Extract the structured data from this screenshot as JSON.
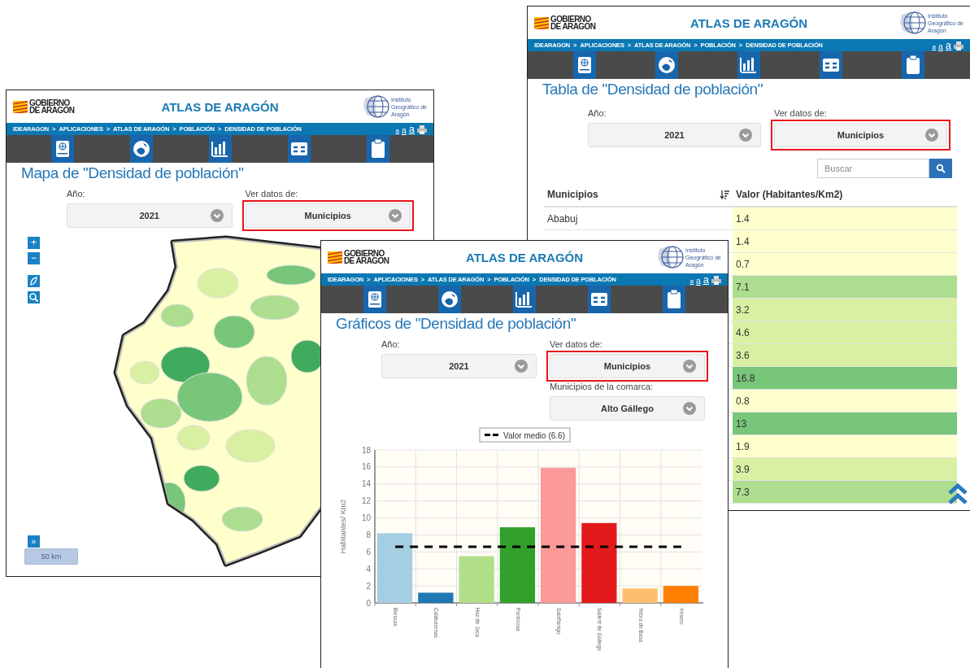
{
  "windows": [
    {
      "kind": "map",
      "logo": {
        "line_1": "GOBIERNO",
        "line_2": "DE ARAGON"
      },
      "site_title": "ATLAS DE ARAGÓN",
      "institute": [
        "Instituto",
        "Geográfico de",
        "Aragón"
      ],
      "breadcrumb": [
        "IDEARAGON",
        "APLICACIONES",
        "ATLAS DE ARAGÓN",
        "POBLACIÓN",
        "DENSIDAD DE POBLACIÓN"
      ],
      "separator": ">",
      "font_sizes": [
        "a",
        "a",
        "a"
      ],
      "page_title": "Mapa de \"Densidad de población\"",
      "year": {
        "label": "Año:",
        "value": "2021"
      },
      "view": {
        "label": "Ver datos de:",
        "value": "Municipios",
        "highlighted": true
      },
      "map": {
        "zoom_in": "+",
        "zoom_out": "−",
        "expand": "»",
        "scale": "50 km"
      }
    },
    {
      "kind": "table",
      "logo": {
        "line_1": "GOBIERNO",
        "line_2": "DE ARAGON"
      },
      "site_title": "ATLAS DE ARAGÓN",
      "institute": [
        "Instituto",
        "Geográfico de",
        "Aragón"
      ],
      "breadcrumb": [
        "IDEARAGON",
        "APLICACIONES",
        "ATLAS DE ARAGÓN",
        "POBLACIÓN",
        "DENSIDAD DE POBLACIÓN"
      ],
      "separator": ">",
      "font_sizes": [
        "a",
        "a",
        "a"
      ],
      "page_title": "Tabla de \"Densidad de población\"",
      "year": {
        "label": "Año:",
        "value": "2021"
      },
      "view": {
        "label": "Ver datos de:",
        "value": "Municipios",
        "highlighted": true
      },
      "search": {
        "placeholder": "Buscar"
      },
      "table": {
        "columns": [
          "Municipios",
          "Valor (Habitantes/Km2)"
        ],
        "rows": [
          {
            "name": "Ababuj",
            "value": "1.4",
            "color": "#ffffcc"
          },
          {
            "value": "1.4",
            "color": "#ffffcc"
          },
          {
            "value": "0.7",
            "color": "#ffffcc"
          },
          {
            "value": "7.1",
            "color": "#addd8e"
          },
          {
            "value": "3.2",
            "color": "#d9f0a3"
          },
          {
            "value": "4.6",
            "color": "#d9f0a3"
          },
          {
            "value": "3.6",
            "color": "#d9f0a3"
          },
          {
            "value": "16.8",
            "color": "#78c679"
          },
          {
            "value": "0.8",
            "color": "#ffffcc"
          },
          {
            "value": "13",
            "color": "#78c679"
          },
          {
            "value": "1.9",
            "color": "#ffffcc"
          },
          {
            "value": "3.9",
            "color": "#d9f0a3"
          },
          {
            "value": "7.3",
            "color": "#addd8e"
          }
        ]
      }
    },
    {
      "kind": "chart",
      "logo": {
        "line_1": "GOBIERNO",
        "line_2": "DE ARAGON"
      },
      "site_title": "ATLAS DE ARAGÓN",
      "institute": [
        "Instituto",
        "Geográfico de",
        "Aragón"
      ],
      "breadcrumb": [
        "IDEARAGON",
        "APLICACIONES",
        "ATLAS DE ARAGÓN",
        "POBLACIÓN",
        "DENSIDAD DE POBLACIÓN"
      ],
      "separator": ">",
      "font_sizes": [
        "a",
        "a",
        "a"
      ],
      "page_title": "Gráficos de \"Densidad de población\"",
      "year": {
        "label": "Año:",
        "value": "2021"
      },
      "view": {
        "label": "Ver datos de:",
        "value": "Municipios",
        "highlighted": true
      },
      "comarca": {
        "label": "Municipios de la comarca:",
        "value": "Alto Gállego"
      },
      "chart_data": {
        "type": "bar",
        "ylabel": "Habitantes/ Km2",
        "categories": [
          "Biescas",
          "Caldearenas",
          "Hoz de Jaca",
          "Panticosa",
          "Sabiñánigo",
          "Sallent de Gállego",
          "Yebra de Basa",
          "Yésero"
        ],
        "series": [
          {
            "colors": [
              "#a6cee3",
              "#1f78b4",
              "#b2df8a",
              "#33a02c",
              "#fb9a99",
              "#e31a1c",
              "#fdbf6f",
              "#ff7f00"
            ],
            "values": [
              8.2,
              1.2,
              5.5,
              8.9,
              15.9,
              9.4,
              1.7,
              2.0
            ]
          },
          {
            "name": "Valor medio (6.6)",
            "type": "line",
            "line_style": "dashed",
            "color": "#000000",
            "values": [
              6.6,
              6.6,
              6.6,
              6.6,
              6.6,
              6.6,
              6.6,
              6.6
            ]
          }
        ],
        "ylim": [
          0,
          18
        ],
        "yticks": [
          0,
          2,
          4,
          6,
          8,
          10,
          12,
          14,
          16,
          18
        ],
        "grid": true
      }
    }
  ]
}
